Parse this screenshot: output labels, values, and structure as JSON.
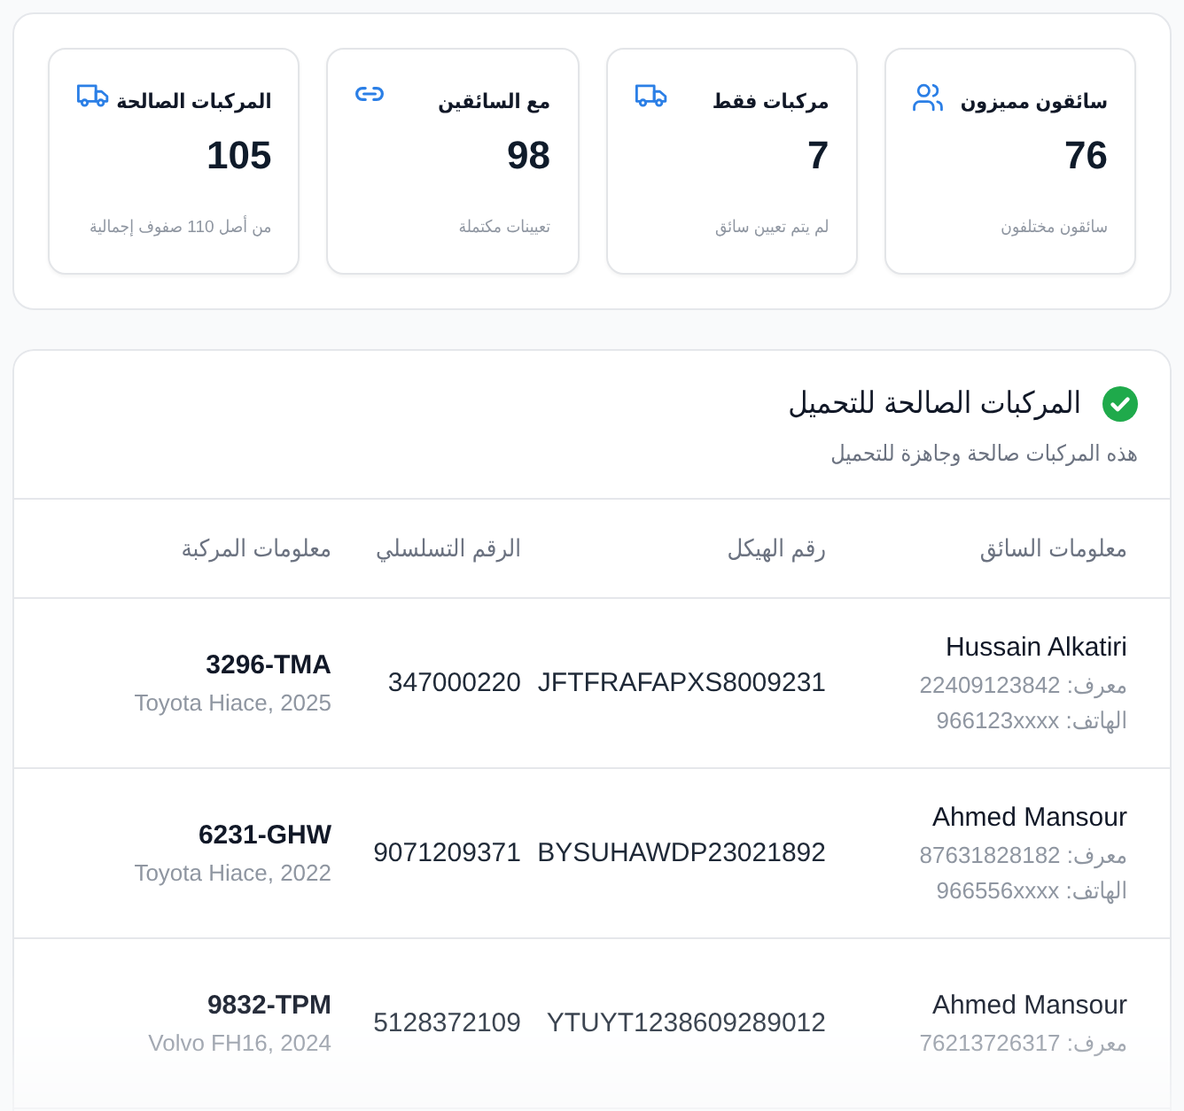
{
  "stats": [
    {
      "kind": "users",
      "title": "سائقون مميزون",
      "value": "76",
      "caption": "سائقون مختلفون"
    },
    {
      "kind": "truck",
      "title": "مركبات فقط",
      "value": "7",
      "caption": "لم يتم تعيين سائق"
    },
    {
      "kind": "link",
      "title": "مع السائقين",
      "value": "98",
      "caption": "تعيينات مكتملة"
    },
    {
      "kind": "truck",
      "title": "المركبات الصالحة",
      "value": "105",
      "caption": "من أصل 110 صفوف إجمالية"
    }
  ],
  "section": {
    "title": "المركبات الصالحة للتحميل",
    "subtitle": "هذه المركبات صالحة وجاهزة للتحميل"
  },
  "table": {
    "columns": [
      "معلومات السائق",
      "رقم الهيكل",
      "الرقم التسلسلي",
      "معلومات المركبة"
    ],
    "rows": [
      {
        "driver": "Hussain Alkatiri",
        "driver_id": "معرف: 22409123842",
        "phone": "الهاتف: 966123xxxx",
        "chassis": "JFTFRAFAPXS8009231",
        "serial": "347000220",
        "plate": "3296-TMA",
        "model": "Toyota Hiace, 2025"
      },
      {
        "driver": "Ahmed Mansour",
        "driver_id": "معرف: 87631828182",
        "phone": "الهاتف: 966556xxxx",
        "chassis": "BYSUHAWDP23021892",
        "serial": "9071209371",
        "plate": "6231-GHW",
        "model": "Toyota Hiace, 2022"
      },
      {
        "driver": "Ahmed Mansour",
        "driver_id": "معرف: 76213726317",
        "chassis": "YTUYT1238609289012",
        "serial": "5128372109",
        "plate": "9832-TPM",
        "model": "Volvo FH16, 2024"
      }
    ]
  }
}
